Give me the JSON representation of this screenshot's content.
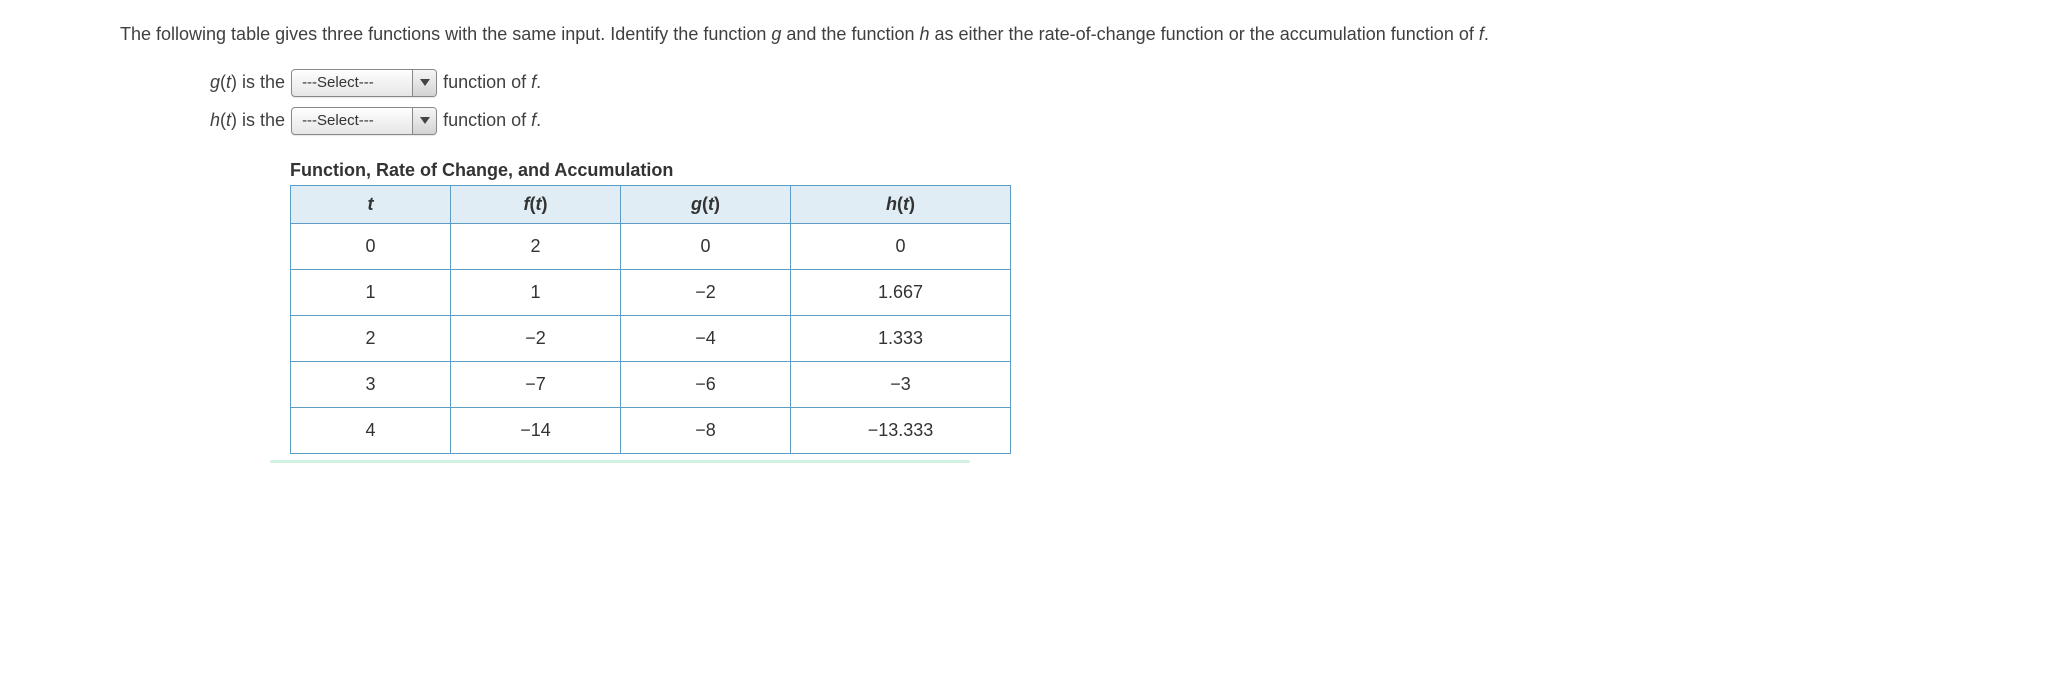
{
  "intro": {
    "part1": "The following table gives three functions with the same input. Identify the function ",
    "g": "g",
    "part2": " and the function ",
    "h": "h",
    "part3": " as either the rate-of-change function or the accumulation function of ",
    "f": "f",
    "part4": "."
  },
  "statements": {
    "g": {
      "lhs1": "g",
      "lhs2": "(",
      "lhs3": "t",
      "lhs4": ") is the",
      "select": "---Select---",
      "suffix1": "function of ",
      "f": "f",
      "suffix2": "."
    },
    "h": {
      "lhs1": "h",
      "lhs2": "(",
      "lhs3": "t",
      "lhs4": ") is the",
      "select": "---Select---",
      "suffix1": "function of ",
      "f": "f",
      "suffix2": "."
    }
  },
  "table": {
    "title": "Function, Rate of Change, and Accumulation",
    "headers": {
      "t": "t",
      "ft_f": "f",
      "ft_paren": "(",
      "ft_t": "t",
      "ft_close": ")",
      "gt_g": "g",
      "gt_paren": "(",
      "gt_t": "t",
      "gt_close": ")",
      "ht_h": "h",
      "ht_paren": "(",
      "ht_t": "t",
      "ht_close": ")"
    },
    "rows": [
      {
        "t": "0",
        "f": "2",
        "g": "0",
        "h": "0"
      },
      {
        "t": "1",
        "f": "1",
        "g": "−2",
        "h": "1.667"
      },
      {
        "t": "2",
        "f": "−2",
        "g": "−4",
        "h": "1.333"
      },
      {
        "t": "3",
        "f": "−7",
        "g": "−6",
        "h": "−3"
      },
      {
        "t": "4",
        "f": "−14",
        "g": "−8",
        "h": "−13.333"
      }
    ]
  },
  "chart_data": {
    "type": "table",
    "title": "Function, Rate of Change, and Accumulation",
    "columns": [
      "t",
      "f(t)",
      "g(t)",
      "h(t)"
    ],
    "data": [
      [
        0,
        2,
        0,
        0
      ],
      [
        1,
        1,
        -2,
        1.667
      ],
      [
        2,
        -2,
        -4,
        1.333
      ],
      [
        3,
        -7,
        -6,
        -3
      ],
      [
        4,
        -14,
        -8,
        -13.333
      ]
    ]
  }
}
